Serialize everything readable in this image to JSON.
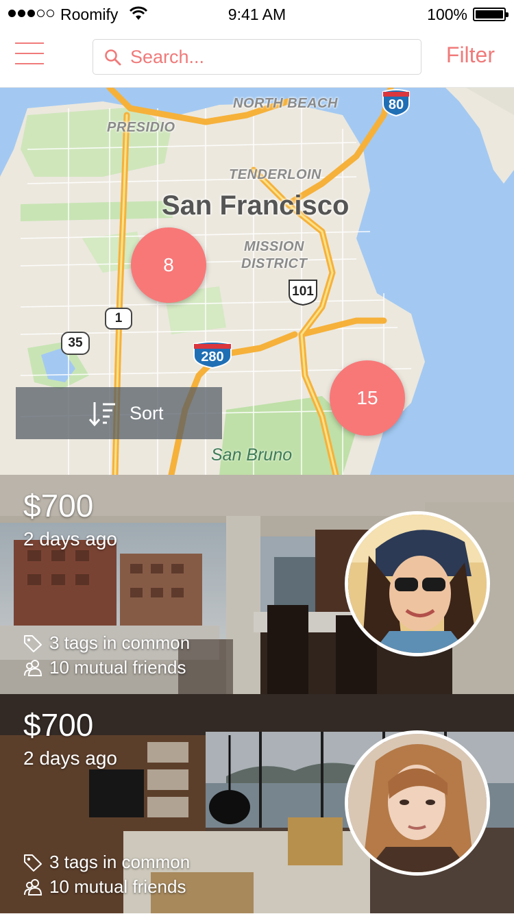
{
  "status_bar": {
    "carrier": "Roomify",
    "time": "9:41 AM",
    "battery": "100%"
  },
  "nav": {
    "search_placeholder": "Search...",
    "filter_label": "Filter"
  },
  "map": {
    "city": "San Francisco",
    "neighborhoods": {
      "north_beach": "NORTH BEACH",
      "presidio": "PRESIDIO",
      "tenderloin": "TENDERLOIN",
      "mission_district_1": "MISSION",
      "mission_district_2": "DISTRICT",
      "san_bruno": "San Bruno"
    },
    "highways": {
      "i80": "80",
      "i280": "280",
      "us101": "101",
      "hwy1": "1",
      "hwy35": "35"
    },
    "clusters": [
      {
        "count": "8"
      },
      {
        "count": "15"
      }
    ],
    "sort_label": "Sort"
  },
  "listings": [
    {
      "price": "$700",
      "posted": "2 days ago",
      "tags": "3 tags in common",
      "friends": "10 mutual friends"
    },
    {
      "price": "$700",
      "posted": "2 days ago",
      "tags": "3 tags in common",
      "friends": "10 mutual friends"
    }
  ],
  "colors": {
    "accent": "#f07a7a",
    "cluster": "#f87878",
    "water": "#a3c9f2",
    "land": "#ece8de",
    "park": "#c8e4b4",
    "highway": "#f6b13a"
  }
}
